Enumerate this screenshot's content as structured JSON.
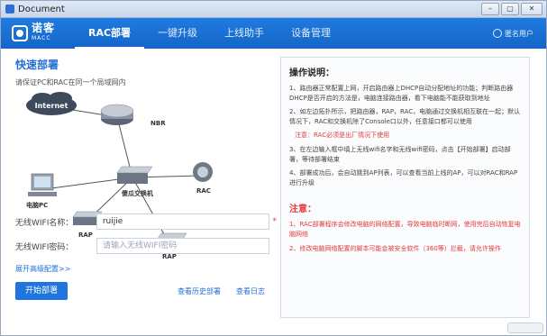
{
  "window": {
    "title": "Document",
    "buttons": {
      "minimize": "–",
      "restore": "▢",
      "close": "✕"
    }
  },
  "nav": {
    "logo_cn": "诺客",
    "logo_en": "MACC",
    "items": [
      "RAC部署",
      "一键升级",
      "上线助手",
      "设备管理"
    ],
    "active_index": 0,
    "user": "匿名用户"
  },
  "quick_deploy": {
    "title": "快速部署",
    "subtitle": "请保证PC和RAC在同一个局域网内",
    "diagram": {
      "internet": "Internet",
      "nbr": "NBR",
      "switch": "傻瓜交换机",
      "pc": "电脑PC",
      "rac": "RAC",
      "ap1": "RAP",
      "ap2": "RAP"
    },
    "wifi_name_label": "无线WIFI名称：",
    "wifi_name_value": "ruijie",
    "required_mark": "*",
    "wifi_pwd_label": "无线WIFI密码：",
    "wifi_pwd_placeholder": "请输入无线WIFI密码",
    "advanced_link": "展开高级配置>>",
    "start_button": "开始部署",
    "history_link": "查看历史部署",
    "log_link": "查看日志"
  },
  "instructions": {
    "title": "操作说明：",
    "items": [
      "1、路由器正常配置上网，开启路由器上DHCP自动分配地址的功能；判断路由器DHCP是否开启的方法是，电脑连接路由器，看下电脑能不能获取到地址",
      "2、如左边拓扑所示，把路由器，RAP，RAC，电脑通过交换机相互联在一起；默认情况下，RAC和交换机除了Console口以外，任意接口都可以使用",
      "3、在左边输入框中填上无线wifi名字和无线wifi密码，点击【开始部署】启动部署，等待部署结束",
      "4、部署成功后，会自动跳到AP列表，可以查看当前上线的AP，可以对RAC和RAP进行升级"
    ],
    "note": "注意：RAC必须是出厂情况下使用",
    "warning_title": "注意：",
    "warnings": [
      "1、RAC部署程序会修改电脑的网络配置，导致电脑临时断网，使用完后自动恢复电脑网络",
      "2、修改电脑网络配置的脚本可能会被安全软件（360等）拦截，请允许操作"
    ]
  }
}
